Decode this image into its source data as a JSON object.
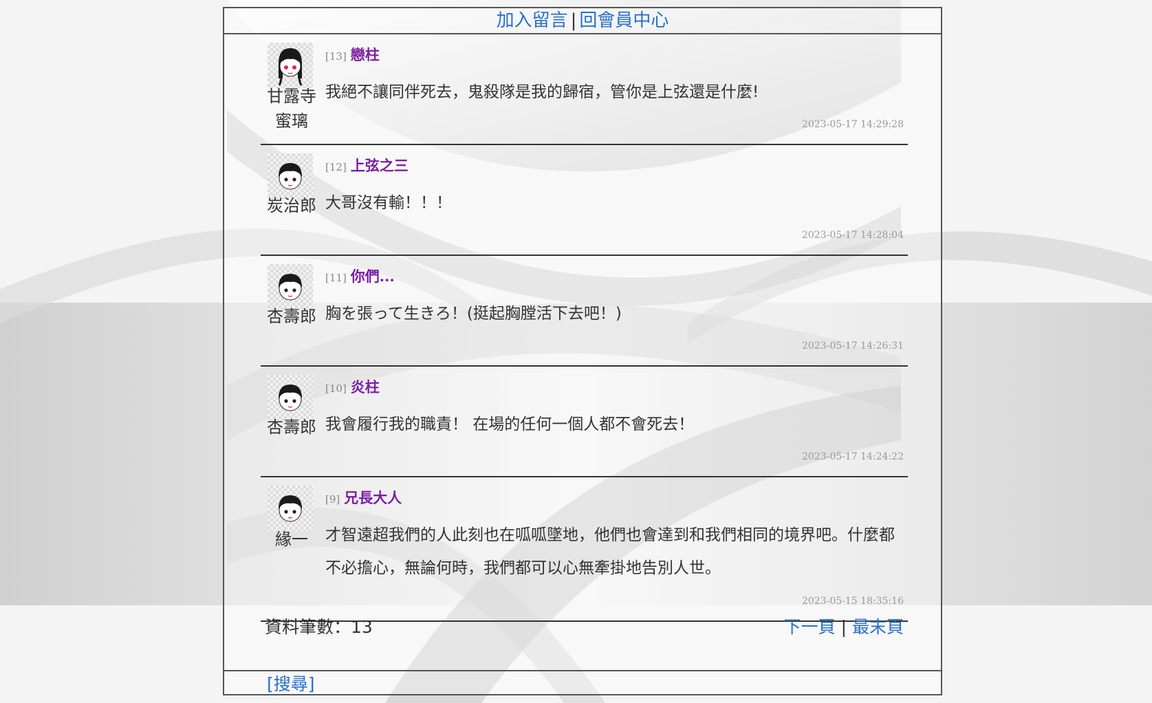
{
  "topbar": {
    "add_label": "加入留言",
    "separator": "|",
    "member_label": "回會員中心"
  },
  "entries": [
    {
      "num": "[13]",
      "title": "戀柱",
      "author_line1": "甘露寺",
      "author_line2": "蜜璃",
      "body": "我絕不讓同伴死去，鬼殺隊是我的歸宿，管你是上弦還是什麼!",
      "time": "2023-05-17 14:29:28",
      "avatar_icon": "girl-avatar-icon"
    },
    {
      "num": "[12]",
      "title": "上弦之三",
      "author_line1": "炭治郎",
      "author_line2": "",
      "body": "大哥沒有輸！！！",
      "time": "2023-05-17 14:28:04",
      "avatar_icon": "boy-avatar-icon"
    },
    {
      "num": "[11]",
      "title": "你們...",
      "author_line1": "杏壽郎",
      "author_line2": "",
      "body": "胸を張って生きろ！(挺起胸膛活下去吧！)",
      "time": "2023-05-17 14:26:31",
      "avatar_icon": "boy-avatar-icon"
    },
    {
      "num": "[10]",
      "title": "炎柱",
      "author_line1": "杏壽郎",
      "author_line2": "",
      "body": "我會履行我的職責！ 在場的任何一個人都不會死去！",
      "time": "2023-05-17 14:24:22",
      "avatar_icon": "boy-avatar-icon"
    },
    {
      "num": "[9]",
      "title": "兄長大人",
      "author_line1": "緣一",
      "author_line2": "",
      "body": "才智遠超我們的人此刻也在呱呱墜地，他們也會達到和我們相同的境界吧。什麼都不必擔心，無論何時，我們都可以心無牽掛地告別人世。",
      "time": "2023-05-15 18:35:16",
      "avatar_icon": "boy-avatar-icon"
    }
  ],
  "footer": {
    "count_label": "資料筆數：13",
    "next_label": "下一頁",
    "separator": "|",
    "last_label": "最末頁"
  },
  "search": {
    "label": "[搜尋]"
  },
  "colors": {
    "link": "#2a6fc9",
    "title": "#7b1fa2"
  }
}
